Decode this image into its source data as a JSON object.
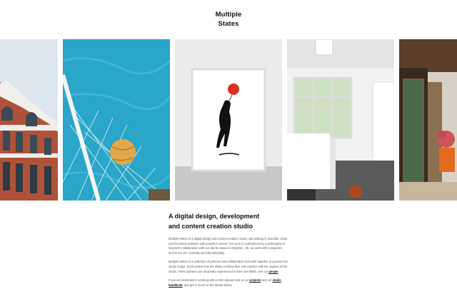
{
  "site": {
    "logo_line1": "Multiple",
    "logo_line2": "States"
  },
  "gallery": {
    "tiles": [
      {
        "name": "building-photo"
      },
      {
        "name": "pool-ball-photo"
      },
      {
        "name": "framed-print-photo"
      },
      {
        "name": "interior-photo"
      },
      {
        "name": "doorway-photo"
      }
    ]
  },
  "intro": {
    "headline_line1": "A digital design, development",
    "headline_line2": "and content creation studio",
    "p1": "Multiple States is a digital design and content creation studio, specialising in beautiful, clean and functional websites with powerful content. Our work is underpinned by a philosophy of long-term collaboration with our clients. Based in Brighton, UK, we work with companies across the UK, Australia and internationally.",
    "p2_before": "Multiple States is a collection of partners and collaborators that work together to produce the studio output. Each partner has the ability to follow their own practice with the support of the studio. These partners are all greatly experienced in their own fields. See our ",
    "p2_link": "people",
    "p2_after": ".",
    "p3_before": "If you are interested in working with us then please look at our ",
    "p3_link1": "projects",
    "p3_mid": " and our ",
    "p3_link2": "studio handbook",
    "p3_after": ", and get in touch on the details below."
  },
  "colors": {
    "pool": "#2aa6c9",
    "brick": "#b0523a",
    "balloon": "#d93025",
    "ball": "#e0a84a"
  }
}
